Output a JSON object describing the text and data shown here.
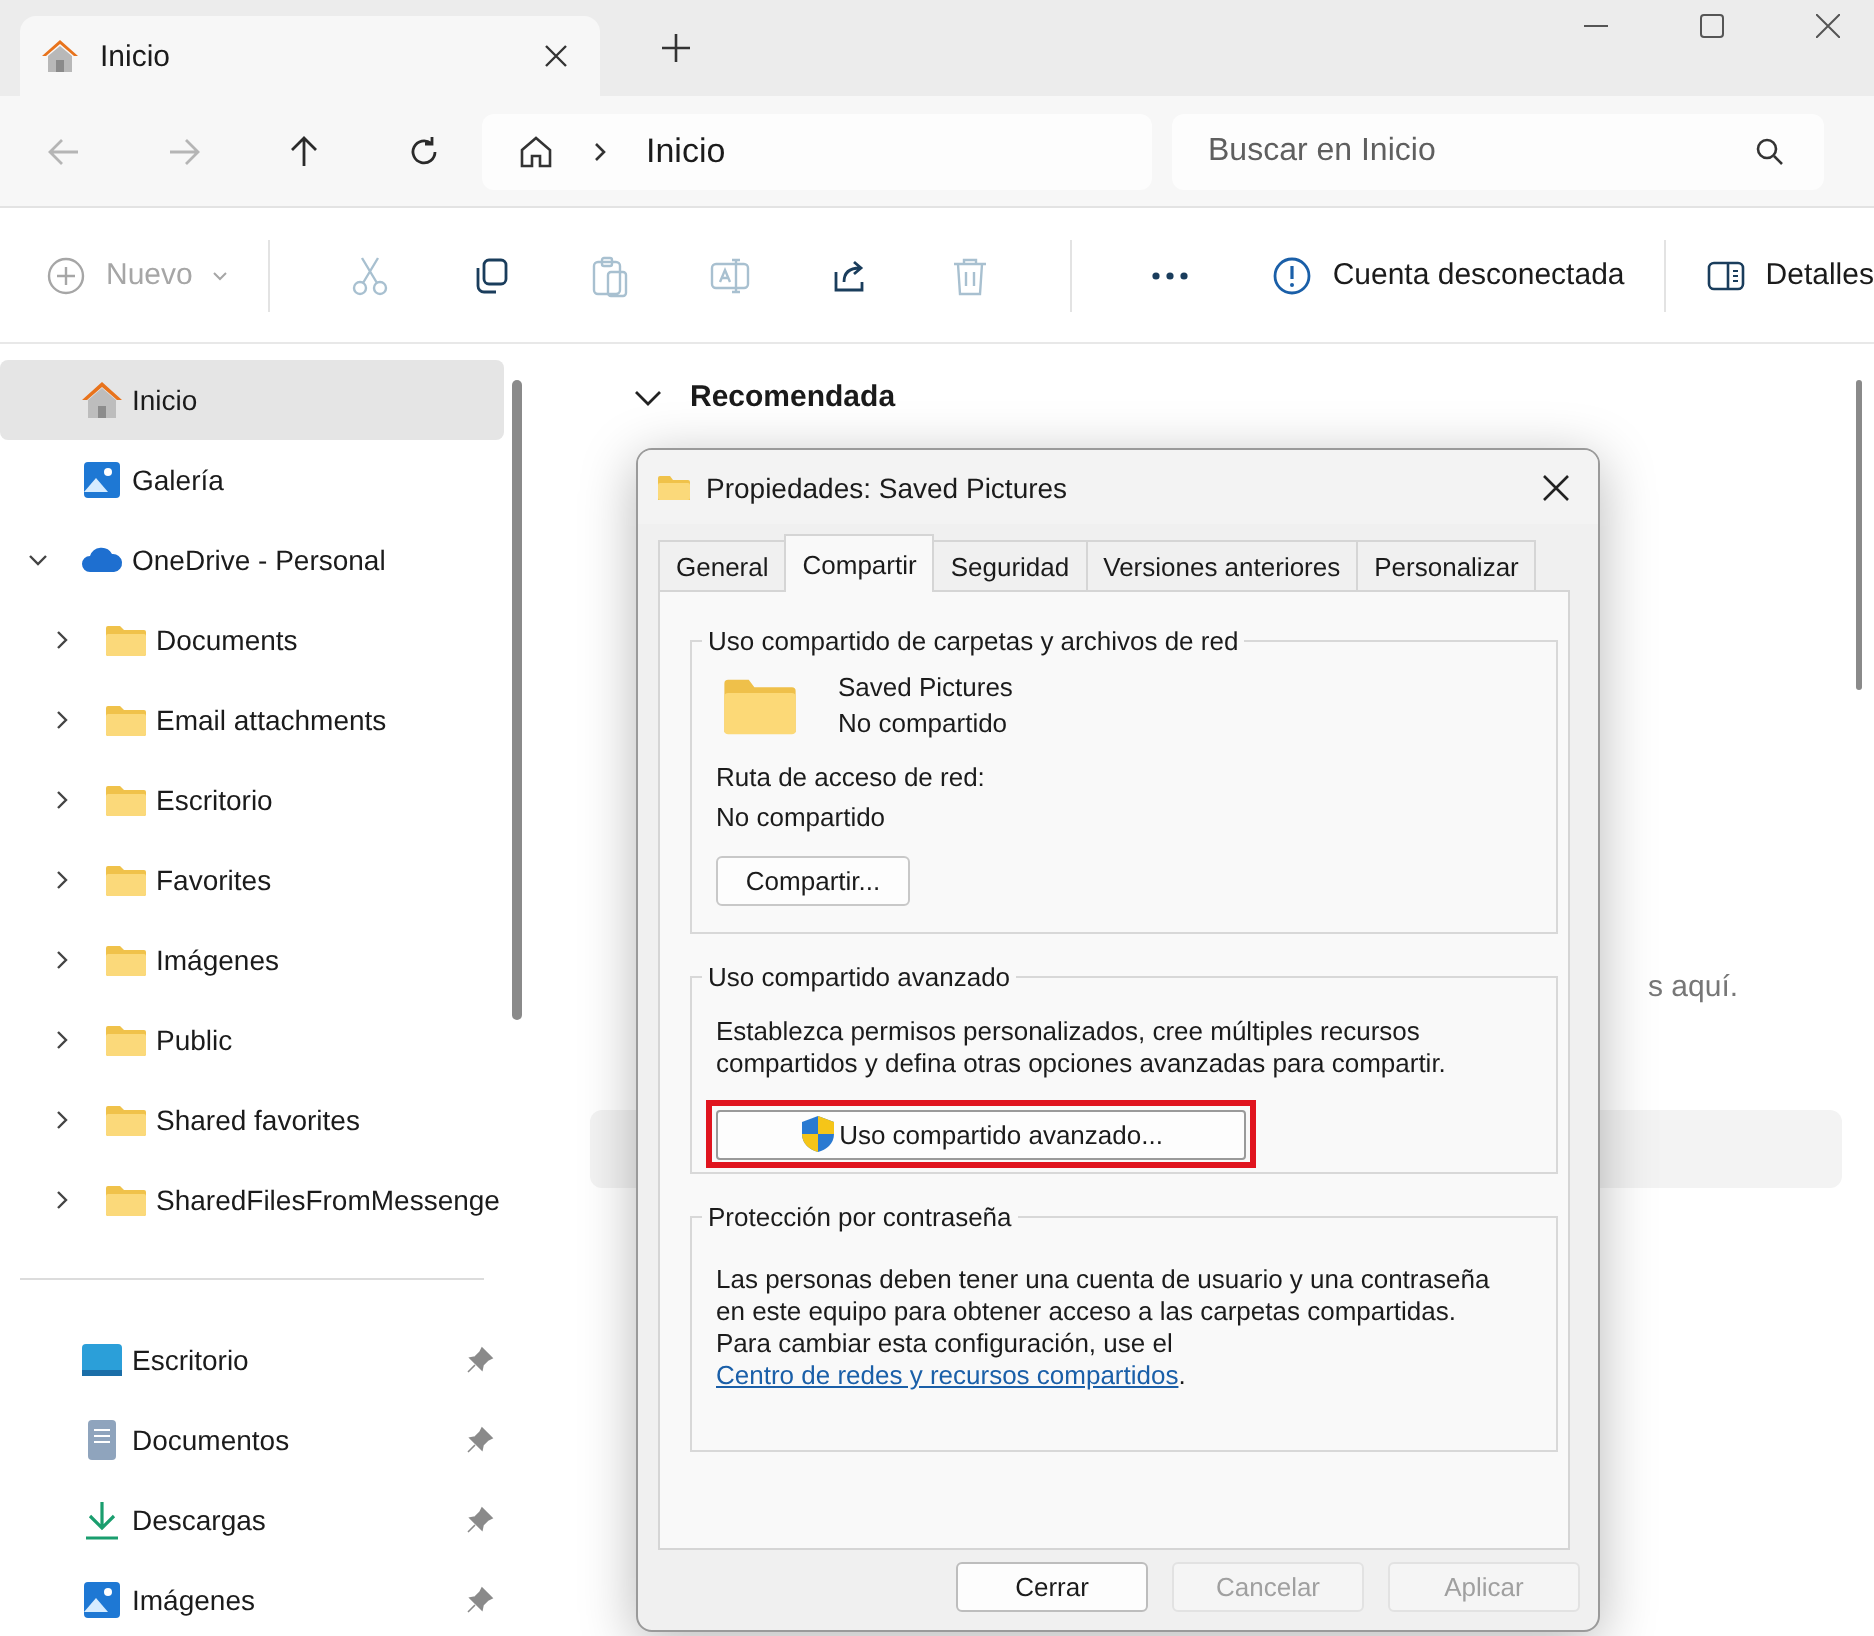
{
  "tabs": [
    {
      "label": "Inicio",
      "selected": true
    }
  ],
  "nav_buttons": [
    {
      "kind": "back",
      "disabled": true
    },
    {
      "kind": "forward",
      "disabled": true
    },
    {
      "kind": "up",
      "disabled": false
    },
    {
      "kind": "refresh",
      "disabled": false
    }
  ],
  "address": {
    "path": [
      "Inicio"
    ]
  },
  "search": {
    "placeholder": "Buscar en Inicio"
  },
  "command_bar": {
    "items": [
      {
        "kind": "new",
        "label": "Nuevo",
        "disabled": true
      },
      {
        "kind": "cut",
        "disabled": true
      },
      {
        "kind": "copy",
        "disabled": false
      },
      {
        "kind": "paste",
        "disabled": true
      },
      {
        "kind": "rename",
        "disabled": true
      },
      {
        "kind": "share",
        "disabled": false
      },
      {
        "kind": "delete",
        "disabled": true
      },
      {
        "kind": "more",
        "disabled": false
      }
    ],
    "status": "Cuenta desconectada",
    "details": "Detalles"
  },
  "sidebar": {
    "items": [
      {
        "label": "Inicio",
        "kind": "home",
        "selected": true
      },
      {
        "label": "Galería",
        "kind": "gallery",
        "selected": false
      },
      {
        "label": "OneDrive - Personal",
        "kind": "cloud",
        "selected": false,
        "expanded": true,
        "children": [
          {
            "label": "Documents",
            "kind": "folder",
            "selected": false,
            "expanded": false
          },
          {
            "label": "Email attachments",
            "kind": "folder",
            "selected": false,
            "expanded": false
          },
          {
            "label": "Escritorio",
            "kind": "folder",
            "selected": false,
            "expanded": false
          },
          {
            "label": "Favorites",
            "kind": "folder",
            "selected": false,
            "expanded": false
          },
          {
            "label": "Imágenes",
            "kind": "folder",
            "selected": false,
            "expanded": false
          },
          {
            "label": "Public",
            "kind": "folder",
            "selected": false,
            "expanded": false
          },
          {
            "label": "Shared favorites",
            "kind": "folder",
            "selected": false,
            "expanded": false
          },
          {
            "label": "SharedFilesFromMessenge",
            "kind": "folder",
            "selected": false,
            "expanded": false
          }
        ]
      }
    ],
    "pinned": [
      {
        "label": "Escritorio",
        "kind": "desktop"
      },
      {
        "label": "Documentos",
        "kind": "document"
      },
      {
        "label": "Descargas",
        "kind": "download"
      },
      {
        "label": "Imágenes",
        "kind": "pictures"
      }
    ]
  },
  "content": {
    "section_title": "Recomendada",
    "expanded": true,
    "partial_text": "s aquí."
  },
  "dialog": {
    "title": "Propiedades: Saved Pictures",
    "tabs": [
      {
        "label": "General",
        "selected": false
      },
      {
        "label": "Compartir",
        "selected": true
      },
      {
        "label": "Seguridad",
        "selected": false
      },
      {
        "label": "Versiones anteriores",
        "selected": false
      },
      {
        "label": "Personalizar",
        "selected": false
      }
    ],
    "network_sharing": {
      "legend": "Uso compartido de carpetas y archivos de red",
      "folder_name": "Saved Pictures",
      "folder_status": "No compartido",
      "path_label": "Ruta de acceso de red:",
      "path_value": "No compartido",
      "button": "Compartir..."
    },
    "advanced_sharing": {
      "legend": "Uso compartido avanzado",
      "description": "Establezca permisos personalizados, cree múltiples recursos compartidos y defina otras opciones avanzadas para compartir.",
      "button": "Uso compartido avanzado...",
      "highlighted": true
    },
    "password_protection": {
      "legend": "Protección por contraseña",
      "text": "Las personas deben tener una cuenta de usuario y una contraseña en este equipo para obtener acceso a las carpetas compartidas. Para cambiar esta configuración, use el ",
      "link": "Centro de redes y recursos compartidos",
      "after_link": "."
    },
    "buttons": [
      {
        "label": "Cerrar",
        "disabled": false
      },
      {
        "label": "Cancelar",
        "disabled": true
      },
      {
        "label": "Aplicar",
        "disabled": true
      }
    ]
  }
}
